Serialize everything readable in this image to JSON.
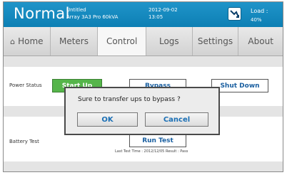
{
  "header": {
    "mode": "Normal",
    "device_line1": "Untitled",
    "device_line2": "Array 3A3 Pro 60kVA",
    "date": "2012-09-02",
    "time": "13:05",
    "load_label": "Load :",
    "load_value": "40%"
  },
  "tabs": [
    {
      "label": "Home"
    },
    {
      "label": "Meters"
    },
    {
      "label": "Control"
    },
    {
      "label": "Logs"
    },
    {
      "label": "Settings"
    },
    {
      "label": "About"
    }
  ],
  "power": {
    "label": "Power Status",
    "start_label": "Start Up",
    "bypass_label": "Bypass",
    "shutdown_label": "Shut Down"
  },
  "battery": {
    "label": "Battery Test",
    "run_label": "Run Test",
    "last_test": "Last Test Time : 2012/12/05    Result : Pass"
  },
  "dialog": {
    "message": "Sure to transfer ups to bypass ?",
    "ok_label": "OK",
    "cancel_label": "Cancel"
  }
}
